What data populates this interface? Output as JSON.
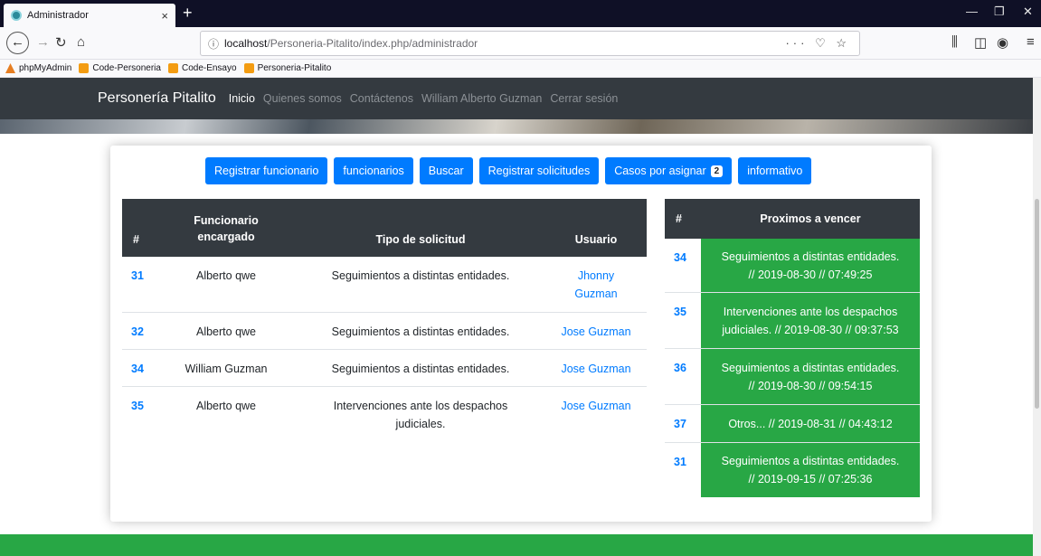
{
  "browser": {
    "tab_title": "Administrador",
    "tab_close": "×",
    "new_tab": "+",
    "url_host": "localhost",
    "url_path": "/Personeria-Pitalito/index.php/administrador",
    "url_actions": "··· ♡ ☆",
    "bookmarks": [
      "phpMyAdmin",
      "Code-Personeria",
      "Code-Ensayo",
      "Personeria-Pitalito"
    ]
  },
  "site": {
    "brand": "Personería Pitalito",
    "nav": [
      "Inicio",
      "Quienes somos",
      "Contáctenos",
      "William Alberto Guzman",
      "Cerrar sesión"
    ]
  },
  "actions": {
    "registrar_funcionario": "Registrar funcionario",
    "funcionarios": "funcionarios",
    "buscar": "Buscar",
    "registrar_solicitudes": "Registrar solicitudes",
    "casos_por_asignar": "Casos por asignar",
    "casos_count": "2",
    "informativo": "informativo"
  },
  "main_table": {
    "headers": {
      "id": "#",
      "funcionario_1": "Funcionario",
      "funcionario_2": "encargado",
      "tipo": "Tipo de solicitud",
      "usuario": "Usuario"
    },
    "rows": [
      {
        "id": "31",
        "funcionario": "Alberto qwe",
        "tipo_1": "Seguimientos a distintas entidades.",
        "tipo_2": "",
        "usuario_1": "Jhonny",
        "usuario_2": "Guzman"
      },
      {
        "id": "32",
        "funcionario": "Alberto qwe",
        "tipo_1": "Seguimientos a distintas entidades.",
        "tipo_2": "",
        "usuario_1": "Jose Guzman",
        "usuario_2": ""
      },
      {
        "id": "34",
        "funcionario": "William Guzman",
        "tipo_1": "Seguimientos a distintas entidades.",
        "tipo_2": "",
        "usuario_1": "Jose Guzman",
        "usuario_2": ""
      },
      {
        "id": "35",
        "funcionario": "Alberto qwe",
        "tipo_1": "Intervenciones ante los despachos",
        "tipo_2": "judiciales.",
        "usuario_1": "Jose Guzman",
        "usuario_2": ""
      }
    ]
  },
  "side_table": {
    "headers": {
      "id": "#",
      "title": "Proximos a vencer"
    },
    "rows": [
      {
        "id": "34",
        "line_1": "Seguimientos a distintas entidades.",
        "line_2": "// 2019-08-30 // 07:49:25"
      },
      {
        "id": "35",
        "line_1": "Intervenciones ante los despachos",
        "line_2": "judiciales. // 2019-08-30 // 09:37:53"
      },
      {
        "id": "36",
        "line_1": "Seguimientos a distintas entidades.",
        "line_2": "// 2019-08-30 // 09:54:15"
      },
      {
        "id": "37",
        "line_1": "Otros... // 2019-08-31 // 04:43:12",
        "line_2": ""
      },
      {
        "id": "31",
        "line_1": "Seguimientos a distintas entidades.",
        "line_2": "// 2019-09-15 // 07:25:36"
      }
    ]
  },
  "colors": {
    "primary": "#007bff",
    "success": "#28a745",
    "dark": "#343a40"
  }
}
